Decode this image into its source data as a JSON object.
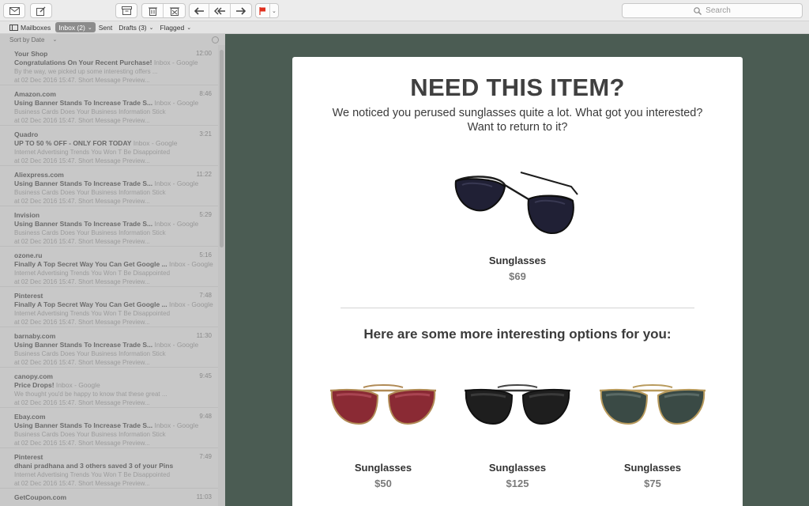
{
  "search": {
    "placeholder": "Search"
  },
  "favorites": [
    {
      "label": "Mailboxes"
    },
    {
      "label": "Inbox (2)"
    },
    {
      "label": "Sent"
    },
    {
      "label": "Drafts (3)"
    },
    {
      "label": "Flagged"
    }
  ],
  "sort": {
    "label": "Sort by Date"
  },
  "messages": [
    {
      "from": "Your Shop",
      "time": "12:00",
      "subject": "Congratulations On Your Recent Purchase!",
      "folder": "Inbox - Google",
      "preview1": "By the way, we picked up some interesting offers ...",
      "preview2": "at 02 Dec 2016 15:47. Short Message Preview..."
    },
    {
      "from": "Amazon.com",
      "time": "8:46",
      "subject": "Using Banner Stands To Increase Trade S...",
      "folder": "Inbox - Google",
      "preview1": "Business Cards Does Your Business Information Stick",
      "preview2": "at 02 Dec 2016 15:47. Short Message Preview..."
    },
    {
      "from": "Quadro",
      "time": "3:21",
      "subject": "UP TO 50 % OFF - ONLY FOR TODAY",
      "folder": "Inbox - Google",
      "preview1": "Internet Advertising Trends You Won T Be Disappointed",
      "preview2": "at 02 Dec 2016 15:47. Short Message Preview..."
    },
    {
      "from": "Aliexpress.com",
      "time": "11:22",
      "subject": "Using Banner Stands To Increase Trade S...",
      "folder": "Inbox - Google",
      "preview1": "Business Cards Does Your Business Information Stick",
      "preview2": "at 02 Dec 2016 15:47. Short Message Preview..."
    },
    {
      "from": "Invision",
      "time": "5:29",
      "subject": "Using Banner Stands To Increase Trade S...",
      "folder": "Inbox - Google",
      "preview1": "Business Cards Does Your Business Information Stick",
      "preview2": "at 02 Dec 2016 15:47. Short Message Preview..."
    },
    {
      "from": "ozone.ru",
      "time": "5:16",
      "subject": "Finally A Top Secret Way You Can Get Google ...",
      "folder": "Inbox - Google",
      "preview1": "Internet Advertising Trends You Won T Be Disappointed",
      "preview2": "at 02 Dec 2016 15:47. Short Message Preview..."
    },
    {
      "from": "Pinterest",
      "time": "7:48",
      "subject": "Finally A Top Secret Way You Can Get Google ...",
      "folder": "Inbox - Google",
      "preview1": "Internet Advertising Trends You Won T Be Disappointed",
      "preview2": "at 02 Dec 2016 15:47. Short Message Preview..."
    },
    {
      "from": "barnaby.com",
      "time": "11:30",
      "subject": "Using Banner Stands To Increase Trade S...",
      "folder": "Inbox - Google",
      "preview1": "Business Cards Does Your Business Information Stick",
      "preview2": "at 02 Dec 2016 15:47. Short Message Preview..."
    },
    {
      "from": "canopy.com",
      "time": "9:45",
      "subject": "Price Drops!",
      "folder": "Inbox - Google",
      "preview1": "We thought you'd be happy to know that these great ...",
      "preview2": "at 02 Dec 2016 15:47. Short Message Preview..."
    },
    {
      "from": "Ebay.com",
      "time": "9:48",
      "subject": "Using Banner Stands To Increase Trade S...",
      "folder": "Inbox - Google",
      "preview1": "Business Cards Does Your Business Information Stick",
      "preview2": "at 02 Dec 2016 15:47. Short Message Preview..."
    },
    {
      "from": "Pinterest",
      "time": "7:49",
      "subject": "dhani pradhana and 3 others saved 3 of your Pins",
      "folder": "",
      "preview1": "Internet Advertising Trends You Won T Be Disappointed",
      "preview2": "at 02 Dec 2016 15:47. Short Message Preview..."
    },
    {
      "from": "GetCoupon.com",
      "time": "11:03",
      "subject": "",
      "folder": "",
      "preview1": "",
      "preview2": ""
    }
  ],
  "email": {
    "headline": "NEED THIS ITEM?",
    "subtext": "We noticed you perused sunglasses quite a lot. What got you interested? Want to return to it?",
    "hero": {
      "name": "Sunglasses",
      "price": "$69"
    },
    "options_title": "Here are some more interesting options for you:",
    "products": [
      {
        "name": "Sunglasses",
        "price": "$50"
      },
      {
        "name": "Sunglasses",
        "price": "$125"
      },
      {
        "name": "Sunglasses",
        "price": "$75"
      }
    ]
  },
  "colors": {
    "reading_pane_bg": "#4b5c53",
    "flag": "#e0301e",
    "lens_red": "#8a2a34",
    "lens_black": "#1e1e1e",
    "lens_green": "#3a4a45",
    "hero_lens": "#202035"
  },
  "icons": [
    "envelope-icon",
    "compose-icon",
    "archive-icon",
    "trash-icon",
    "junk-icon",
    "reply-icon",
    "reply-all-icon",
    "forward-icon",
    "flag-icon",
    "search-icon",
    "mailboxes-icon"
  ]
}
